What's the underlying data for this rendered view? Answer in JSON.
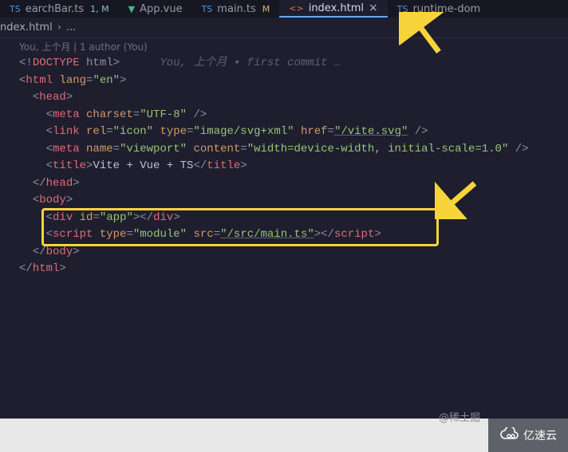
{
  "tabs": [
    {
      "icon": "ts",
      "label": "earchBar.ts",
      "status": "1, M"
    },
    {
      "icon": "vue",
      "label": "App.vue",
      "status": ""
    },
    {
      "icon": "ts",
      "label": "main.ts",
      "status": "M"
    },
    {
      "icon": "html",
      "label": "index.html",
      "status": "",
      "active": true
    },
    {
      "icon": "ts",
      "label": "runtime-dom",
      "status": ""
    }
  ],
  "breadcrumb": {
    "file": "ndex.html",
    "sep": "›",
    "rest": "..."
  },
  "blame": "You, 上个月 | 1 author (You)",
  "inline_blame": "You, 上个月 • first commit …",
  "code": {
    "doctype_open": "<!",
    "doctype_kw": "DOCTYPE",
    "doctype_rest": " html",
    "doctype_close": ">",
    "html_tag": "html",
    "lang_attr": "lang",
    "lang_val": "\"en\"",
    "head_tag": "head",
    "meta_tag": "meta",
    "charset_attr": "charset",
    "charset_val": "\"UTF-8\"",
    "link_tag": "link",
    "rel_attr": "rel",
    "rel_val": "\"icon\"",
    "type_attr": "type",
    "link_type_val": "\"image/svg+xml\"",
    "href_attr": "href",
    "href_val": "\"/vite.svg\"",
    "name_attr": "name",
    "viewport_val": "\"viewport\"",
    "content_attr": "content",
    "content_val": "\"width=device-width, initial-scale=1.0\"",
    "title_tag": "title",
    "title_text": "Vite + Vue + TS",
    "body_tag": "body",
    "div_tag": "div",
    "id_attr": "id",
    "app_val": "\"app\"",
    "script_tag": "script",
    "module_val": "\"module\"",
    "src_attr": "src",
    "src_val": "\"/src/main.ts\""
  },
  "watermark": "@稀土掘",
  "logo_text": "亿速云"
}
